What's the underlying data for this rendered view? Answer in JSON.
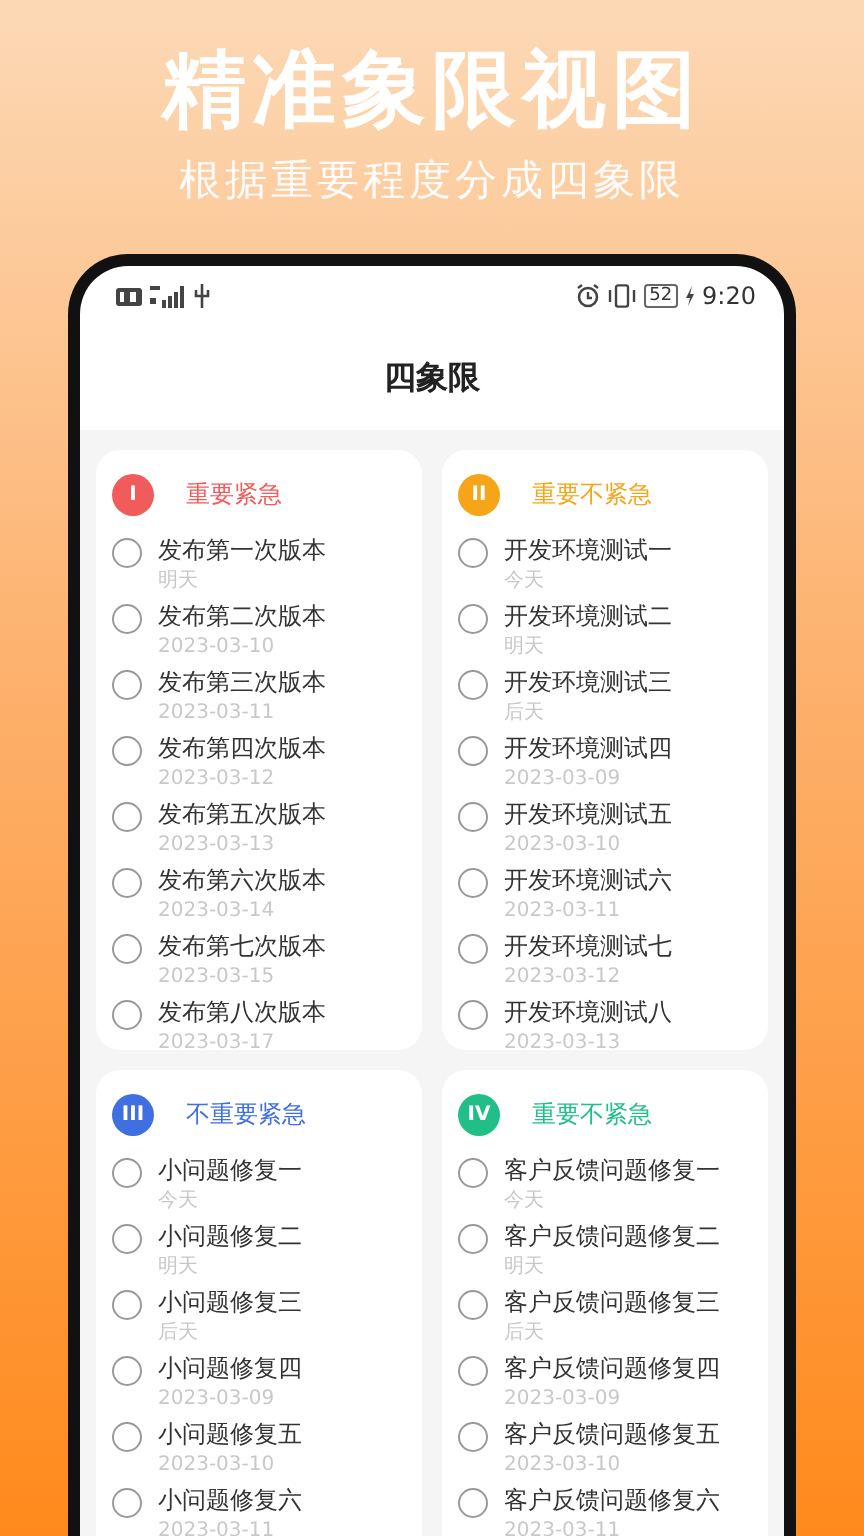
{
  "promo": {
    "title": "精准象限视图",
    "subtitle": "根据重要程度分成四象限"
  },
  "status_bar": {
    "battery": "52",
    "time": "9:20"
  },
  "header": {
    "title": "四象限"
  },
  "quadrants": [
    {
      "numeral": "I",
      "label": "重要紧急",
      "color": "#f25b5b",
      "tasks": [
        {
          "title": "发布第一次版本",
          "due": "明天",
          "checked": false
        },
        {
          "title": "发布第二次版本",
          "due": "2023-03-10",
          "checked": false
        },
        {
          "title": "发布第三次版本",
          "due": "2023-03-11",
          "checked": false
        },
        {
          "title": "发布第四次版本",
          "due": "2023-03-12",
          "checked": false
        },
        {
          "title": "发布第五次版本",
          "due": "2023-03-13",
          "checked": false
        },
        {
          "title": "发布第六次版本",
          "due": "2023-03-14",
          "checked": false
        },
        {
          "title": "发布第七次版本",
          "due": "2023-03-15",
          "checked": false
        },
        {
          "title": "发布第八次版本",
          "due": "2023-03-17",
          "checked": false
        }
      ]
    },
    {
      "numeral": "II",
      "label": "重要不紧急",
      "color": "#f5a517",
      "tasks": [
        {
          "title": "开发环境测试一",
          "due": "今天",
          "checked": false
        },
        {
          "title": "开发环境测试二",
          "due": "明天",
          "checked": false
        },
        {
          "title": "开发环境测试三",
          "due": "后天",
          "checked": false
        },
        {
          "title": "开发环境测试四",
          "due": "2023-03-09",
          "checked": false
        },
        {
          "title": "开发环境测试五",
          "due": "2023-03-10",
          "checked": false
        },
        {
          "title": "开发环境测试六",
          "due": "2023-03-11",
          "checked": false
        },
        {
          "title": "开发环境测试七",
          "due": "2023-03-12",
          "checked": false
        },
        {
          "title": "开发环境测试八",
          "due": "2023-03-13",
          "checked": false
        }
      ]
    },
    {
      "numeral": "III",
      "label": "不重要紧急",
      "color": "#3f6fe0",
      "tasks": [
        {
          "title": "小问题修复一",
          "due": "今天",
          "checked": false
        },
        {
          "title": "小问题修复二",
          "due": "明天",
          "checked": false
        },
        {
          "title": "小问题修复三",
          "due": "后天",
          "checked": false
        },
        {
          "title": "小问题修复四",
          "due": "2023-03-09",
          "checked": false
        },
        {
          "title": "小问题修复五",
          "due": "2023-03-10",
          "checked": false
        },
        {
          "title": "小问题修复六",
          "due": "2023-03-11",
          "checked": false
        }
      ]
    },
    {
      "numeral": "IV",
      "label": "重要不紧急",
      "color": "#21bf88",
      "tasks": [
        {
          "title": "客户反馈问题修复一",
          "due": "今天",
          "checked": false
        },
        {
          "title": "客户反馈问题修复二",
          "due": "明天",
          "checked": false
        },
        {
          "title": "客户反馈问题修复三",
          "due": "后天",
          "checked": false
        },
        {
          "title": "客户反馈问题修复四",
          "due": "2023-03-09",
          "checked": false
        },
        {
          "title": "客户反馈问题修复五",
          "due": "2023-03-10",
          "checked": false
        },
        {
          "title": "客户反馈问题修复六",
          "due": "2023-03-11",
          "checked": false
        }
      ]
    }
  ]
}
